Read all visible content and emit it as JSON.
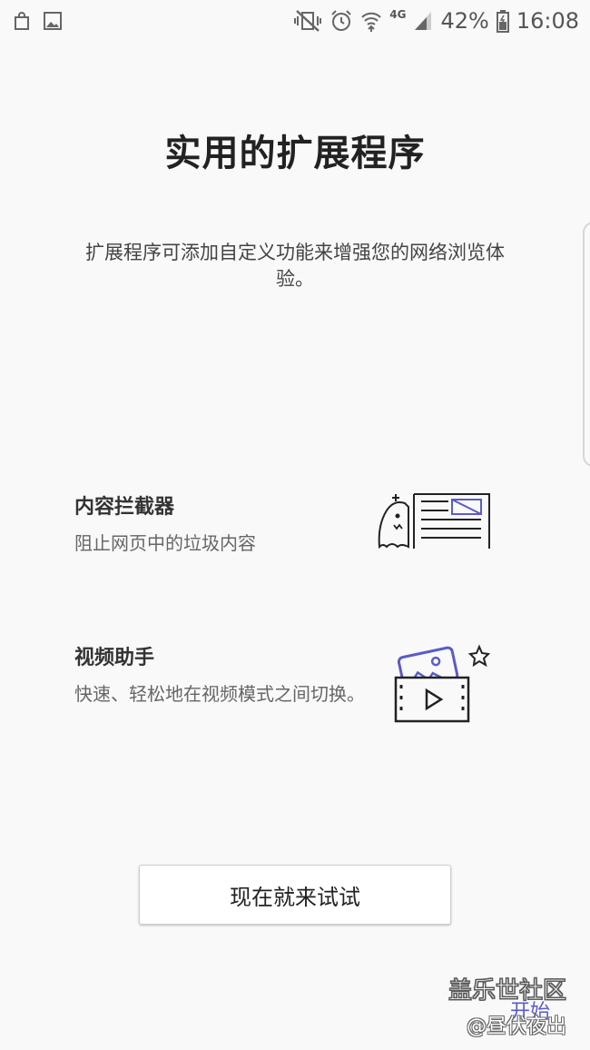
{
  "status_bar": {
    "battery": "42%",
    "time": "16:08",
    "network": "4G",
    "icons": [
      "shopping-bag-icon",
      "gallery-icon",
      "mute-vibrate-icon",
      "alarm-icon",
      "wifi-icon",
      "signal-icon",
      "battery-icon"
    ]
  },
  "title": "实用的扩展程序",
  "subtitle": "扩展程序可添加自定义功能来增强您的网络浏览体验。",
  "features": [
    {
      "title": "内容拦截器",
      "description": "阻止网页中的垃圾内容",
      "icon": "content-blocker-illustration"
    },
    {
      "title": "视频助手",
      "description": "快速、轻松地在视频模式之间切换。",
      "icon": "video-assistant-illustration"
    }
  ],
  "cta_label": "现在就来试试",
  "start_label": "开始",
  "watermark": {
    "line1": "盖乐世社区",
    "line2": "@昼伏夜出"
  },
  "colors": {
    "accent": "#5b5bc9",
    "background": "#f9f9f9"
  }
}
